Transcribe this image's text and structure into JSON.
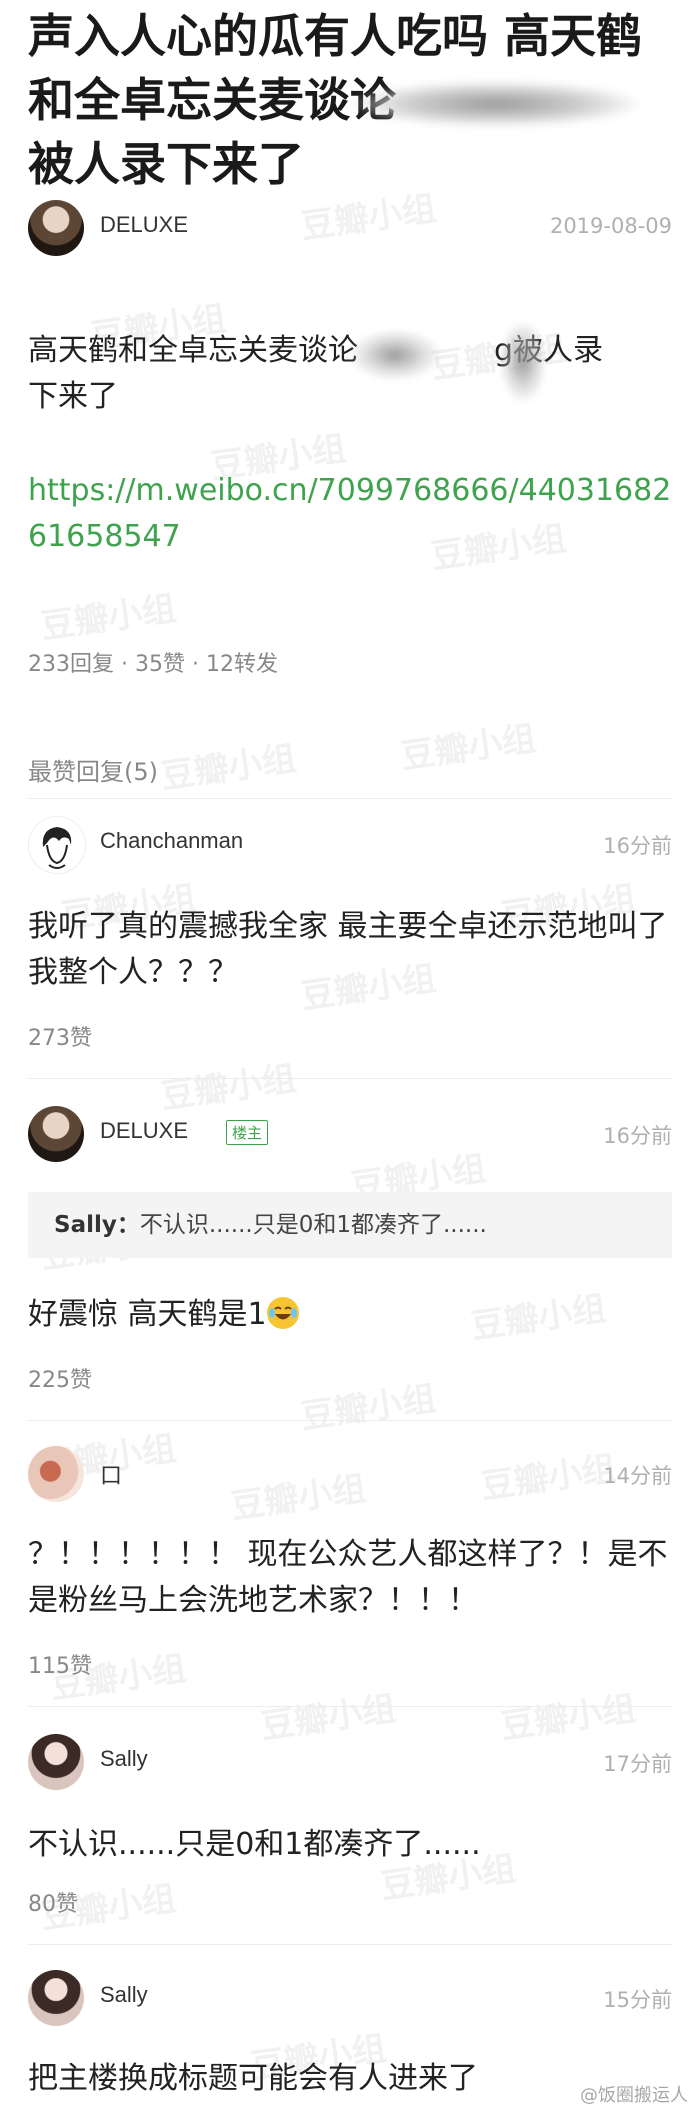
{
  "post": {
    "title": "声入人心的瓜有人吃吗 高天鹤和全卓忘关麦谈论",
    "title_line3": "被人录下来了",
    "author": "DELUXE",
    "date": "2019-08-09",
    "body_a": "高天鹤和全卓忘关麦谈论",
    "body_b": "g被人录",
    "body_c": "下来了",
    "link": "https://m.weibo.cn/7099768666/4403168261658547",
    "stats": "233回复 · 35赞 · 12转发"
  },
  "replies_section": {
    "label": "最赞回复(5)"
  },
  "replies": [
    {
      "user": "Chanchanman",
      "time": "16分前",
      "text": "我听了真的震撼我全家 最主要仝卓还示范地叫了 我整个人？？？",
      "likes": "273赞"
    },
    {
      "user": "DELUXE",
      "badge": "楼主",
      "time": "16分前",
      "quote_name": "Sally：",
      "quote_text": "不认识......只是0和1都凑齐了......",
      "text": "好震惊 高天鹤是1",
      "likes": "225赞"
    },
    {
      "user": "口",
      "time": "14分前",
      "text": "？！！！！！！ 现在公众艺人都这样了？！是不是粉丝马上会洗地艺术家？！！！",
      "likes": "115赞"
    },
    {
      "user": "Sally",
      "time": "17分前",
      "text": "不认识......只是0和1都凑齐了......",
      "likes": "80赞"
    },
    {
      "user": "Sally",
      "time": "15分前",
      "text": "把主楼换成标题可能会有人进来了"
    }
  ],
  "watermark": "豆瓣小组",
  "credit": "@饭圈搬运人",
  "colors": {
    "link": "#3fa34d",
    "badge": "#3fa34d",
    "muted": "#888888"
  }
}
